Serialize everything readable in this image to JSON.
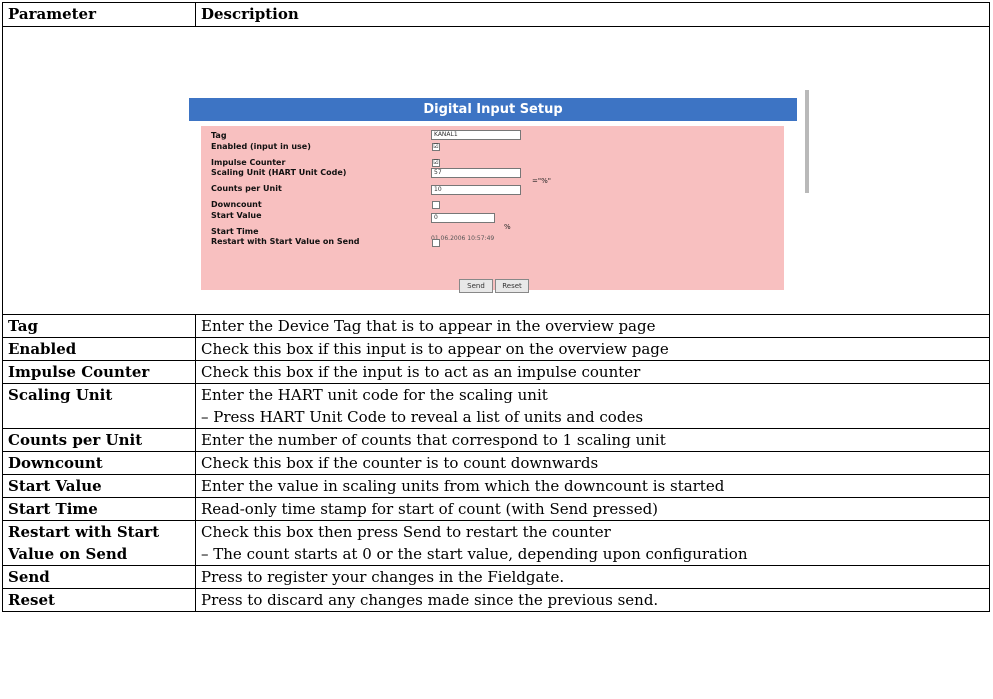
{
  "table": {
    "headers": [
      "Parameter",
      "Description"
    ],
    "rows": [
      {
        "param": "Tag",
        "desc": [
          "Enter the Device Tag that is to appear in the overview page"
        ]
      },
      {
        "param": "Enabled",
        "desc": [
          "Check this box if this input is to appear on the overview page"
        ]
      },
      {
        "param": "Impulse Counter",
        "desc": [
          "Check this box if the input is to act as an impulse counter"
        ]
      },
      {
        "param": "Scaling Unit",
        "desc": [
          "Enter the HART unit code for the scaling unit",
          "–  Press HART Unit Code to reveal a list of units and codes"
        ]
      },
      {
        "param": "Counts per Unit",
        "desc": [
          "Enter the number of counts that correspond to 1 scaling unit"
        ]
      },
      {
        "param": "Downcount",
        "desc": [
          "Check this box if the counter is to count downwards"
        ]
      },
      {
        "param": "Start Value",
        "desc": [
          "Enter the value in scaling units from which the downcount is started"
        ]
      },
      {
        "param": "Start Time",
        "desc": [
          "Read-only time stamp for start of count (with Send pressed)"
        ]
      },
      {
        "param": "Restart with Start Value on Send",
        "desc": [
          "Check this box then press Send to restart the counter",
          "–  The count starts at 0 or the start value, depending upon configuration"
        ]
      },
      {
        "param": "Send",
        "desc": [
          "Press to register your changes in the Fieldgate."
        ]
      },
      {
        "param": "Reset",
        "desc": [
          "Press to discard any changes made since the previous send."
        ]
      }
    ]
  },
  "screenshot": {
    "title": "Digital Input Setup",
    "fields": {
      "tag_label": "Tag",
      "tag_value": "KANAL1",
      "enabled_label": "Enabled (input in use)",
      "impulse_label": "Impulse Counter",
      "scaling_label": "Scaling Unit (HART Unit Code)",
      "scaling_value": "57",
      "scaling_unit": "=\"%\"",
      "counts_label": "Counts per Unit",
      "counts_value": "10",
      "downcount_label": "Downcount",
      "start_value_label": "Start Value",
      "start_value_value": "0",
      "start_value_unit": "%",
      "start_time_label": "Start Time",
      "start_time_value": "01.06.2006 10:57:49",
      "restart_label": "Restart with Start Value on Send",
      "check_glyph": "☑"
    },
    "send_label": "Send",
    "reset_label": "Reset"
  }
}
